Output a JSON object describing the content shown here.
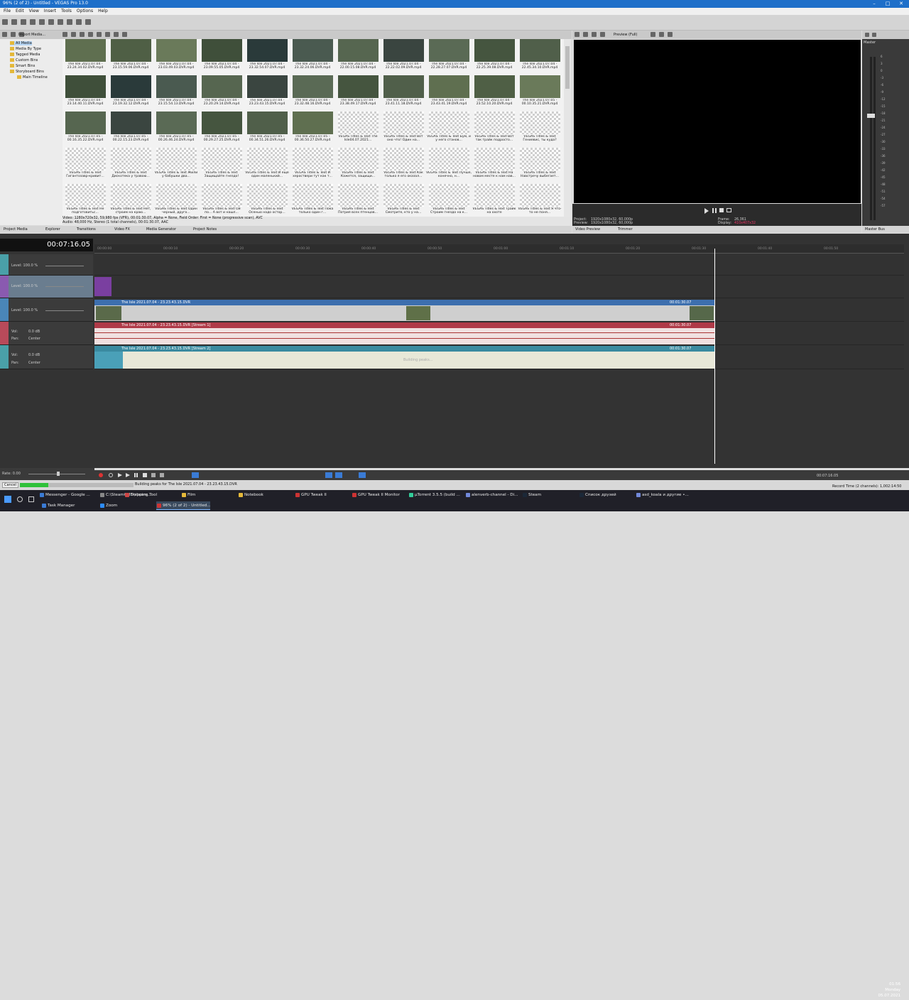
{
  "window": {
    "title": "96% (2 of 2) - Untitled - VEGAS Pro 13.0"
  },
  "menu": [
    "File",
    "Edit",
    "View",
    "Insert",
    "Tools",
    "Options",
    "Help"
  ],
  "media_toolbar": {
    "import_label": "Import Media..."
  },
  "tree": [
    "All Media",
    "Media By Type",
    "Tagged Media",
    "Custom Bins",
    "Smart Bins",
    "Storyboard Bins",
    "Main Timeline"
  ],
  "media": {
    "row1": [
      "The Isle 2021.07.04 - 23.24.34.02.DVR.mp4",
      "The Isle 2021.07.04 - 23.15.59.06.DVR.mp4",
      "The Isle 2021.07.04 - 23.03.49.03.DVR.mp4",
      "The Isle 2021.07.04 - 23.09.55.05.DVR.mp4",
      "The Isle 2021.07.04 - 23.32.54.07.DVR.mp4",
      "The Isle 2021.07.04 - 23.32.24.06.DVR.mp4",
      "The Isle 2021.07.04 - 22.00.15.08.DVR.mp4",
      "The Isle 2021.07.04 - 22.22.02.09.DVR.mp4",
      "The Isle 2021.07.04 - 22.28.27.07.DVR.mp4",
      "The Isle 2021.07.04 - 22.25.39.08.DVR.mp4",
      "The Isle 2021.07.04 - 22.45.34.10.DVR.mp4"
    ],
    "row2": [
      "The Isle 2021.07.04 - 23.14.40.11.DVR.mp4",
      "The Isle 2021.07.04 - 23.19.32.12.DVR.mp4",
      "The Isle 2021.07.04 - 23.15.54.13.DVR.mp4",
      "The Isle 2021.07.04 - 23.20.29.14.DVR.mp4",
      "The Isle 2021.07.04 - 23.23.43.15.DVR.mp4",
      "The Isle 2021.07.04 - 23.32.48.16.DVR.mp4",
      "The Isle 2021.07.04 - 23.38.49.17.DVR.mp4",
      "The Isle 2021.07.04 - 23.41.11.18.DVR.mp4",
      "The Isle 2021.07.04 - 23.43.41.19.DVR.mp4",
      "The Isle 2021.07.04 - 23.52.10.20.DVR.mp4",
      "The Isle 2021.07.05 - 00.10.35.21.DVR.mp4"
    ],
    "row3": [
      "The Isle 2021.07.05 - 00.16.35.22.DVR.mp4",
      "The Isle 2021.07.05 - 00.22.15.23.DVR.mp4",
      "The Isle 2021.07.05 - 00.26.46.24.DVR.mp4",
      "The Isle 2021.07.05 - 00.29.27.25.DVR.mp4",
      "The Isle 2021.07.05 - 00.34.51.26.DVR.mp4",
      "The Isle 2021.07.05 - 00.36.50.27.DVR.mp4",
      "VEGAS Titles & Text The Isle04.07.2021...",
      "VEGAS Titles & Text Вот оно что! Один на...",
      "VEGAS Titles & Text Бум, и у него станов...",
      "VEGAS Titles & Text Вот так трайк подросто...",
      "VEGAS Titles & Text Гениевис, ты куда?"
    ],
    "row4": [
      "VEGAS Titles & Text Гигантозавр-кривит...",
      "VEGAS Titles & Text Дискотека у травою...",
      "VEGAS Titles & Text Жили у бабушки два...",
      "VEGAS Titles & Text Защищайте гнездо!",
      "VEGAS Titles & Text И еще один маленький...",
      "VEGAS Titles & Text И хероствери тут как т...",
      "VEGAS Titles & Text Кажется, защищи...",
      "VEGAS Titles & Text Как только я его оказал...",
      "VEGAS Titles & Text Лучше, конечно, н...",
      "VEGAS Titles & Text На новом месте к нам нав...",
      "VEGAS Titles & Text Навстречу выбегает..."
    ],
    "row5": [
      "VEGAS Titles & Text Не подготовитьс...",
      "VEGAS Titles & Text Нет, строим на краю...",
      "VEGAS Titles & Text Один черный, друго...",
      "VEGAS Titles & Text Ой по... А вот и нашл...",
      "VEGAS Titles & Text Осенью надо остор...",
      "VEGAS Titles & Text Пока только один г...",
      "VEGAS Titles & Text Потрия всех птенцов...",
      "VEGAS Titles & Text Смотрите, кто у на...",
      "VEGAS Titles & Text Строим гнездо на к...",
      "VEGAS Titles & Text Трайк на охоте",
      "VEGAS Titles & Text Я что-то не поня..."
    ]
  },
  "media_info": {
    "video": "Video: 1280x720x32, 59,980 fps (VFR), 00:01:30.07, Alpha = None, Field Order: First = None (progressive scan), AVC",
    "audio": "Audio: 48,000 Hz, Stereo (1 total channels), 00:01:30.07, AAC"
  },
  "tabs_left": [
    "Project Media",
    "Explorer",
    "Transitions",
    "Video FX",
    "Media Generator",
    "Project Notes"
  ],
  "preview": {
    "quality": "Preview (Full)",
    "project_label": "Project:",
    "project_value": "1920x1080x32, 60,000p",
    "preview_label": "Preview:",
    "preview_value": "1920x1080x32, 60,000p",
    "frame_label": "Frame:",
    "frame_value": "26,361",
    "display_label": "Display:",
    "display_value": "410x407x32",
    "tabs": [
      "Video Preview",
      "Trimmer"
    ]
  },
  "master": {
    "title": "Master",
    "scale": [
      "6",
      "3",
      "0",
      "-3",
      "-6",
      "-9",
      "-12",
      "-15",
      "-18",
      "-21",
      "-24",
      "-27",
      "-30",
      "-33",
      "-36",
      "-39",
      "-42",
      "-45",
      "-48",
      "-51",
      "-54",
      "-57"
    ],
    "tab": "Master Bus"
  },
  "timeline": {
    "timecode": "00:07:16.05",
    "ruler": [
      "00:00:00",
      "00:00:10",
      "00:00:20",
      "00:00:30",
      "00:00:40",
      "00:00:50",
      "00:01:00",
      "00:01:10",
      "00:01:20",
      "00:01:30",
      "00:01:40",
      "00:01:50"
    ],
    "tracks": [
      {
        "level": "Level: 100.0 %"
      },
      {
        "level": "Level: 100.0 %"
      },
      {
        "level": "Level: 100.0 %"
      },
      {
        "vol": "Vol:",
        "vol_value": "0.0 dB",
        "pan": "Pan:",
        "pan_value": "Center"
      },
      {
        "vol": "Vol:",
        "vol_value": "0.0 dB",
        "pan": "Pan:",
        "pan_value": "Center"
      }
    ],
    "events": {
      "video": "The Isle 2021.07.04 - 23.23.43.15.DVR",
      "audio1": "The Isle 2021.07.04 - 23.23.43.15.DVR [Stream 1]",
      "audio2": "The Isle 2021.07.04 - 23.23.43.15.DVR [Stream 2]",
      "end_time": "00:01:30.07",
      "building": "Building peaks..."
    }
  },
  "rate": "Rate: 0.00",
  "status": {
    "cancel": "Cancel",
    "progress_text": "Building peaks for The Isle 2021.07.04 - 23.23.43.15.DVR",
    "progress": 0.25,
    "record_time": "Record Time (2 channels): 1,002:14:50",
    "cursor_time": "00:07:16.05"
  },
  "taskbar": {
    "row1": [
      "Messenger - Google ...",
      "C:\\SteamCMD\\steam...",
      "Snipping Tool",
      "Film",
      "Notebook",
      "GPU Tweak II",
      "GPU Tweak II Monitor",
      "μTorrent 3.5.5 (build ...",
      "alenverb-channel - Di...",
      "Steam",
      "Список друзей",
      "asd_koala и другие •..."
    ],
    "row2": [
      "Task Manager",
      "Zoom",
      "96% (2 of 2) - Untitled..."
    ],
    "time": "01:56",
    "day": "Monday",
    "date": "05.07.2021"
  }
}
